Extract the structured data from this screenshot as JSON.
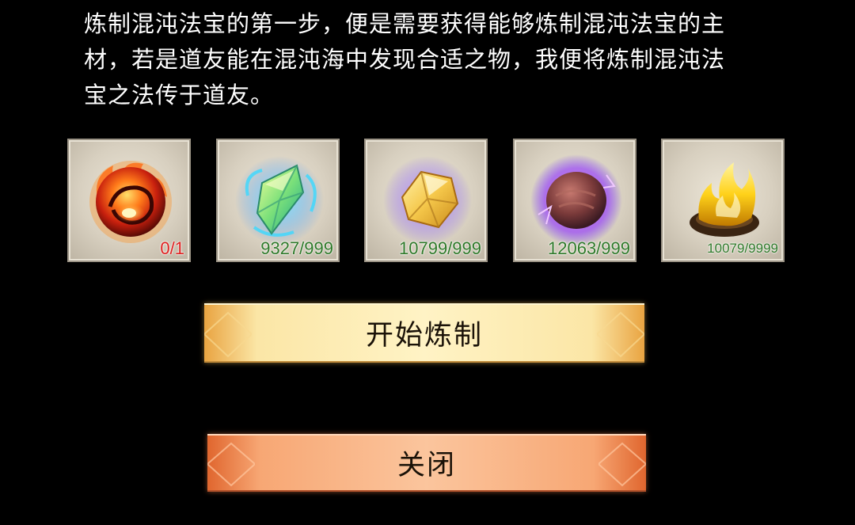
{
  "description": {
    "lines": [
      "炼制混沌法宝的第一步，便是需要获得能够炼制混沌法宝的主",
      "材，若是道友能在混沌海中发现合适之物，我便将炼制混沌法",
      "宝之法传于道友。"
    ]
  },
  "materials": [
    {
      "icon": "fire-orb-icon",
      "count": "0/1",
      "status": "insufficient"
    },
    {
      "icon": "green-crystal-icon",
      "count": "9327/999",
      "status": "sufficient"
    },
    {
      "icon": "gold-crystal-icon",
      "count": "10799/999",
      "status": "sufficient"
    },
    {
      "icon": "purple-stone-icon",
      "count": "12063/999",
      "status": "sufficient"
    },
    {
      "icon": "golden-flame-icon",
      "count": "10079/9999",
      "status": "sufficient"
    }
  ],
  "buttons": {
    "start_label": "开始炼制",
    "close_label": "关闭"
  },
  "colors": {
    "insufficient": "#e02020",
    "sufficient": "#2f7a2a",
    "start_button": "#fbe6a6",
    "close_button": "#f7a774"
  }
}
